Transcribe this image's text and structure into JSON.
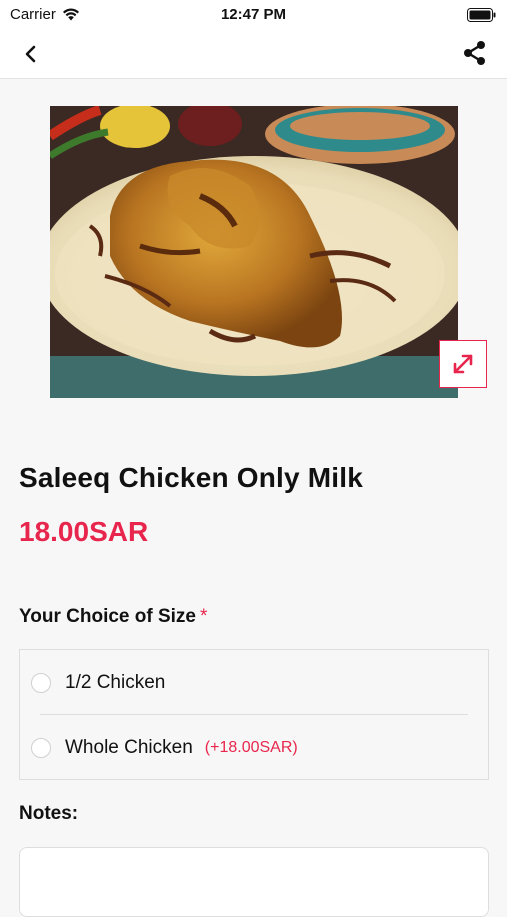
{
  "status_bar": {
    "carrier": "Carrier",
    "time": "12:47 PM",
    "wifi_icon": "wifi-icon",
    "battery_icon": "battery-icon"
  },
  "nav": {
    "back_icon": "chevron-left-icon",
    "share_icon": "share-icon"
  },
  "product": {
    "image_icon": "food-photo",
    "expand_icon": "expand-icon",
    "title": "Saleeq Chicken Only Milk",
    "price": "18.00SAR"
  },
  "size_section": {
    "label": "Your Choice of Size",
    "required_mark": "*",
    "options": [
      {
        "label": "1/2 Chicken",
        "extra": ""
      },
      {
        "label": "Whole Chicken",
        "extra": "(+18.00SAR)"
      }
    ]
  },
  "notes": {
    "label": "Notes:"
  },
  "colors": {
    "accent": "#e8264d",
    "background": "#f7f7f7"
  }
}
